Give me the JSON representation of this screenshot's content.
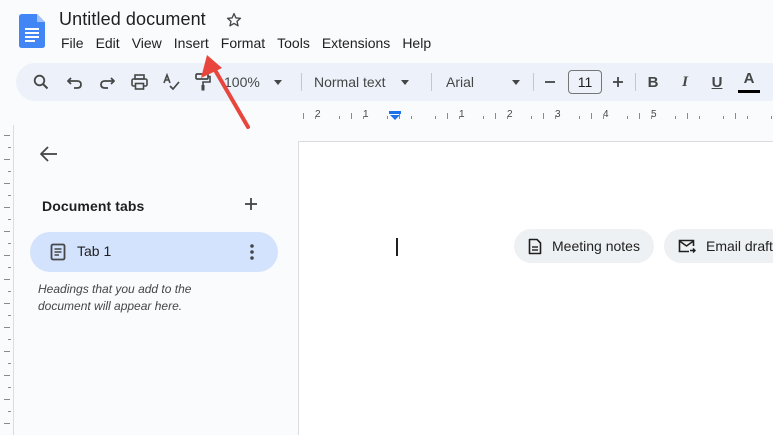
{
  "header": {
    "title": "Untitled document",
    "menu": [
      "File",
      "Edit",
      "View",
      "Insert",
      "Format",
      "Tools",
      "Extensions",
      "Help"
    ]
  },
  "toolbar": {
    "zoom": "100%",
    "style": "Normal text",
    "font": "Arial",
    "font_size": "11",
    "bold": "B",
    "italic": "I",
    "underline": "U",
    "text_color": "A"
  },
  "ruler": {
    "numbers": [
      "2",
      "1",
      "1",
      "2",
      "3",
      "4",
      "5"
    ]
  },
  "panel": {
    "title": "Document tabs",
    "tab_label": "Tab 1",
    "hint": "Headings that you add to the document will appear here."
  },
  "page": {
    "chips": [
      "Meeting notes",
      "Email draft"
    ]
  },
  "colors": {
    "accent_blue": "#1a73e8",
    "doc_icon_blue": "#4285f4",
    "annotation_red": "#e8453c",
    "selected_tab_bg": "#d3e3fd"
  },
  "icons": {
    "logo": "google-docs-logo",
    "star": "star-outline-icon",
    "search": "search-icon",
    "undo": "undo-icon",
    "redo": "redo-icon",
    "print": "print-icon",
    "spellcheck": "spellcheck-icon",
    "paint_format": "paint-format-icon",
    "back": "arrow-back-icon",
    "add": "add-icon",
    "tab": "document-icon",
    "more": "more-vert-icon",
    "meeting": "document-icon",
    "email": "email-forward-icon"
  }
}
